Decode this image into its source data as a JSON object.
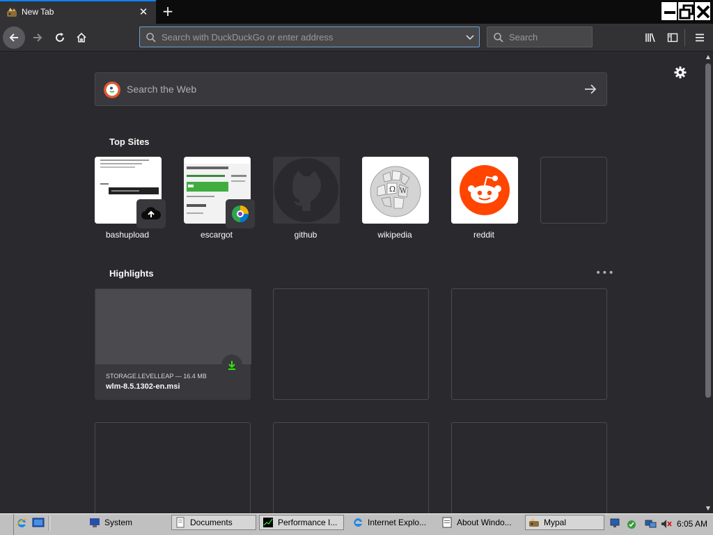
{
  "browser": {
    "tab_title": "New Tab",
    "url_placeholder": "Search with DuckDuckGo or enter address",
    "search_placeholder": "Search"
  },
  "newtab": {
    "web_search_placeholder": "Search the Web",
    "top_sites_heading": "Top Sites",
    "top_sites": [
      {
        "label": "bashupload",
        "icon": "cloud-upload-icon"
      },
      {
        "label": "escargot",
        "icon": "escargot-icon"
      },
      {
        "label": "github",
        "icon": "github-icon"
      },
      {
        "label": "wikipedia",
        "icon": "wikipedia-globe-icon"
      },
      {
        "label": "reddit",
        "icon": "reddit-icon"
      },
      {
        "label": "",
        "icon": ""
      }
    ],
    "highlights_heading": "Highlights",
    "highlight": {
      "source": "STORAGE.LEVELLEAP — 16.4 MB",
      "filename": "wlm-8.5.1302-en.msi"
    }
  },
  "taskbar": {
    "items": [
      {
        "label": "System"
      },
      {
        "label": "Documents"
      },
      {
        "label": "Performance I..."
      },
      {
        "label": "Internet Explo..."
      },
      {
        "label": "About Windo..."
      },
      {
        "label": "Mypal"
      }
    ],
    "clock": "6:05 AM"
  },
  "colors": {
    "accent": "#0a84ff",
    "content_bg": "#2a2a2e",
    "reddit": "#ff4500",
    "download_green": "#30e60b"
  }
}
